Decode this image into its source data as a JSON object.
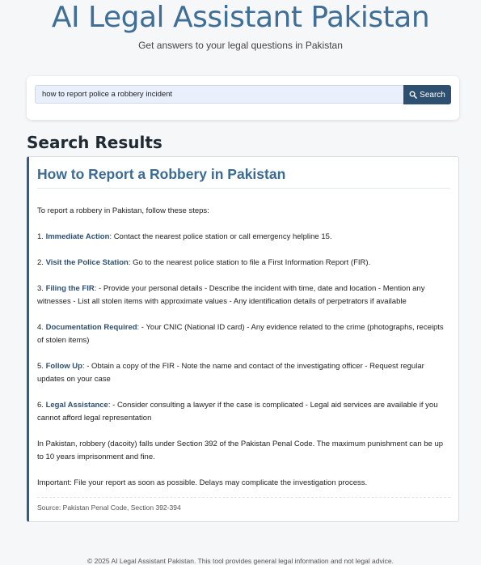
{
  "header": {
    "title": "AI Legal Assistant Pakistan",
    "subtitle": "Get answers to your legal questions in Pakistan"
  },
  "search": {
    "query": "how to report police a robbery incident",
    "button_label": "Search"
  },
  "results": {
    "heading": "Search Results",
    "title": "How to Report a Robbery in Pakistan",
    "intro": "To report a robbery in Pakistan, follow these steps:",
    "steps": [
      {
        "num": "1.",
        "label": "Immediate Action",
        "text": ": Contact the nearest police station or call emergency helpline 15."
      },
      {
        "num": "2.",
        "label": "Visit the Police Station",
        "text": ": Go to the nearest police station to file a First Information Report (FIR)."
      },
      {
        "num": "3.",
        "label": "Filing the FIR",
        "text": ": - Provide your personal details - Describe the incident with time, date and location - Mention any witnesses - List all stolen items with approximate values - Any identification details of perpetrators if available"
      },
      {
        "num": "4.",
        "label": "Documentation Required",
        "text": ": - Your CNIC (National ID card) - Any evidence related to the crime (photographs, receipts of stolen items)"
      },
      {
        "num": "5.",
        "label": "Follow Up",
        "text": ": - Obtain a copy of the FIR - Note the name and contact of the investigating officer - Request regular updates on your case"
      },
      {
        "num": "6.",
        "label": "Legal Assistance",
        "text": ": - Consider consulting a lawyer if the case is complicated - Legal aid services are available if you cannot afford legal representation"
      }
    ],
    "law_note": "In Pakistan, robbery (dacoity) falls under Section 392 of the Pakistan Penal Code. The maximum punishment can be up to 10 years imprisonment and fine.",
    "important": "Important: File your report as soon as possible. Delays may complicate the investigation process.",
    "source": "Source: Pakistan Penal Code, Section 392-394"
  },
  "footer": {
    "text": "© 2025 AI Legal Assistant Pakistan. This tool provides general legal information and not legal advice."
  },
  "colors": {
    "title": "#3f6e96",
    "button": "#2d4f70",
    "accent_border": "#2f5d87"
  },
  "icons": {
    "search_button": "search-icon"
  }
}
